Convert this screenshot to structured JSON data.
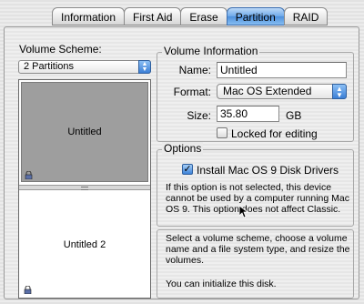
{
  "tabs": [
    {
      "label": "Information",
      "active": false
    },
    {
      "label": "First Aid",
      "active": false
    },
    {
      "label": "Erase",
      "active": false
    },
    {
      "label": "Partition",
      "active": true
    },
    {
      "label": "RAID",
      "active": false
    }
  ],
  "volume_scheme": {
    "label": "Volume Scheme:",
    "selected": "2 Partitions",
    "partitions": [
      {
        "name": "Untitled",
        "selected": true
      },
      {
        "name": "Untitled 2",
        "selected": false
      }
    ]
  },
  "volume_info": {
    "title": "Volume Information",
    "name_label": "Name:",
    "name_value": "Untitled",
    "format_label": "Format:",
    "format_value": "Mac OS Extended",
    "size_label": "Size:",
    "size_value": "35.80",
    "size_unit": "GB",
    "locked_label": "Locked for editing",
    "locked_checked": false
  },
  "options": {
    "title": "Options",
    "install_label": "Install Mac OS 9 Disk Drivers",
    "install_checked": true,
    "desc_lines": [
      "If this option is not selected, this device",
      "cannot be used by a computer running Mac",
      "OS 9.  This option does not affect Classic."
    ]
  },
  "help": {
    "lines": [
      "Select a volume scheme, choose a volume",
      "name and a file system type, and resize the",
      "volumes."
    ],
    "status": "You can initialize this disk."
  },
  "colors": {
    "accent": "#4d8fdc",
    "partition_selected": "#9e9e9e"
  }
}
